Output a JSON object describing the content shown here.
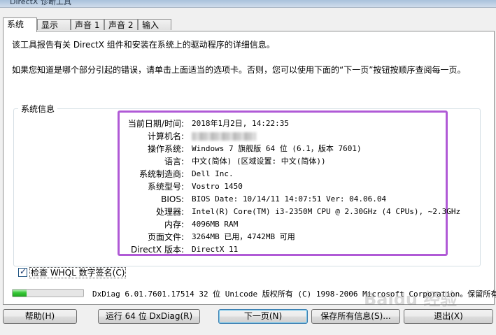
{
  "window": {
    "title": "DirectX 诊断工具"
  },
  "tabs": [
    {
      "label": "系统",
      "active": true
    },
    {
      "label": "显示",
      "active": false
    },
    {
      "label": "声音 1",
      "active": false
    },
    {
      "label": "声音 2",
      "active": false
    },
    {
      "label": "输入",
      "active": false
    }
  ],
  "intro": {
    "line1": "该工具报告有关 DirectX 组件和安装在系统上的驱动程序的详细信息。",
    "line2": "如果您知道是哪个部分引起的错误，请单击上面适当的选项卡。否则，您可以使用下面的“下一页”按钮按顺序查阅每一页。"
  },
  "system_info": {
    "group_title": "系统信息",
    "highlight_color": "#b05ad6",
    "rows": [
      {
        "label": "当前日期/时间:",
        "value": "2018年1月2日, 14:22:35"
      },
      {
        "label": "计算机名:",
        "value": "",
        "blurred": true
      },
      {
        "label": "操作系统:",
        "value": "Windows 7 旗舰版 64 位 (6.1，版本 7601)"
      },
      {
        "label": "语言:",
        "value": "中文(简体) (区域设置: 中文(简体))"
      },
      {
        "label": "系统制造商:",
        "value": "Dell Inc."
      },
      {
        "label": "系统型号:",
        "value": "Vostro 1450"
      },
      {
        "label": "BIOS:",
        "value": "BIOS Date: 10/14/11 14:07:51 Ver: 04.06.04"
      },
      {
        "label": "处理器:",
        "value": "Intel(R) Core(TM) i3-2350M CPU @ 2.30GHz (4 CPUs), ~2.3GHz"
      },
      {
        "label": "内存:",
        "value": "4096MB RAM"
      },
      {
        "label": "页面文件:",
        "value": "3264MB 已用，4742MB 可用"
      },
      {
        "label": "DirectX 版本:",
        "value": "DirectX 11"
      }
    ]
  },
  "whql_check": {
    "label": "检查 WHQL 数字签名(C)",
    "checked": true
  },
  "progress": {
    "percent": 20
  },
  "status_text": "DxDiag 6.01.7601.17514 32 位 Unicode 版权所有 (C) 1998-2006 Microsoft Corporation。保留所有权",
  "buttons": {
    "help": "帮助(H)",
    "run64": "运行 64 位 DxDiag(R)",
    "next": "下一页(N)",
    "save": "保存所有信息(S)...",
    "exit": "退出(X)"
  },
  "watermark": "Baidu 经验"
}
